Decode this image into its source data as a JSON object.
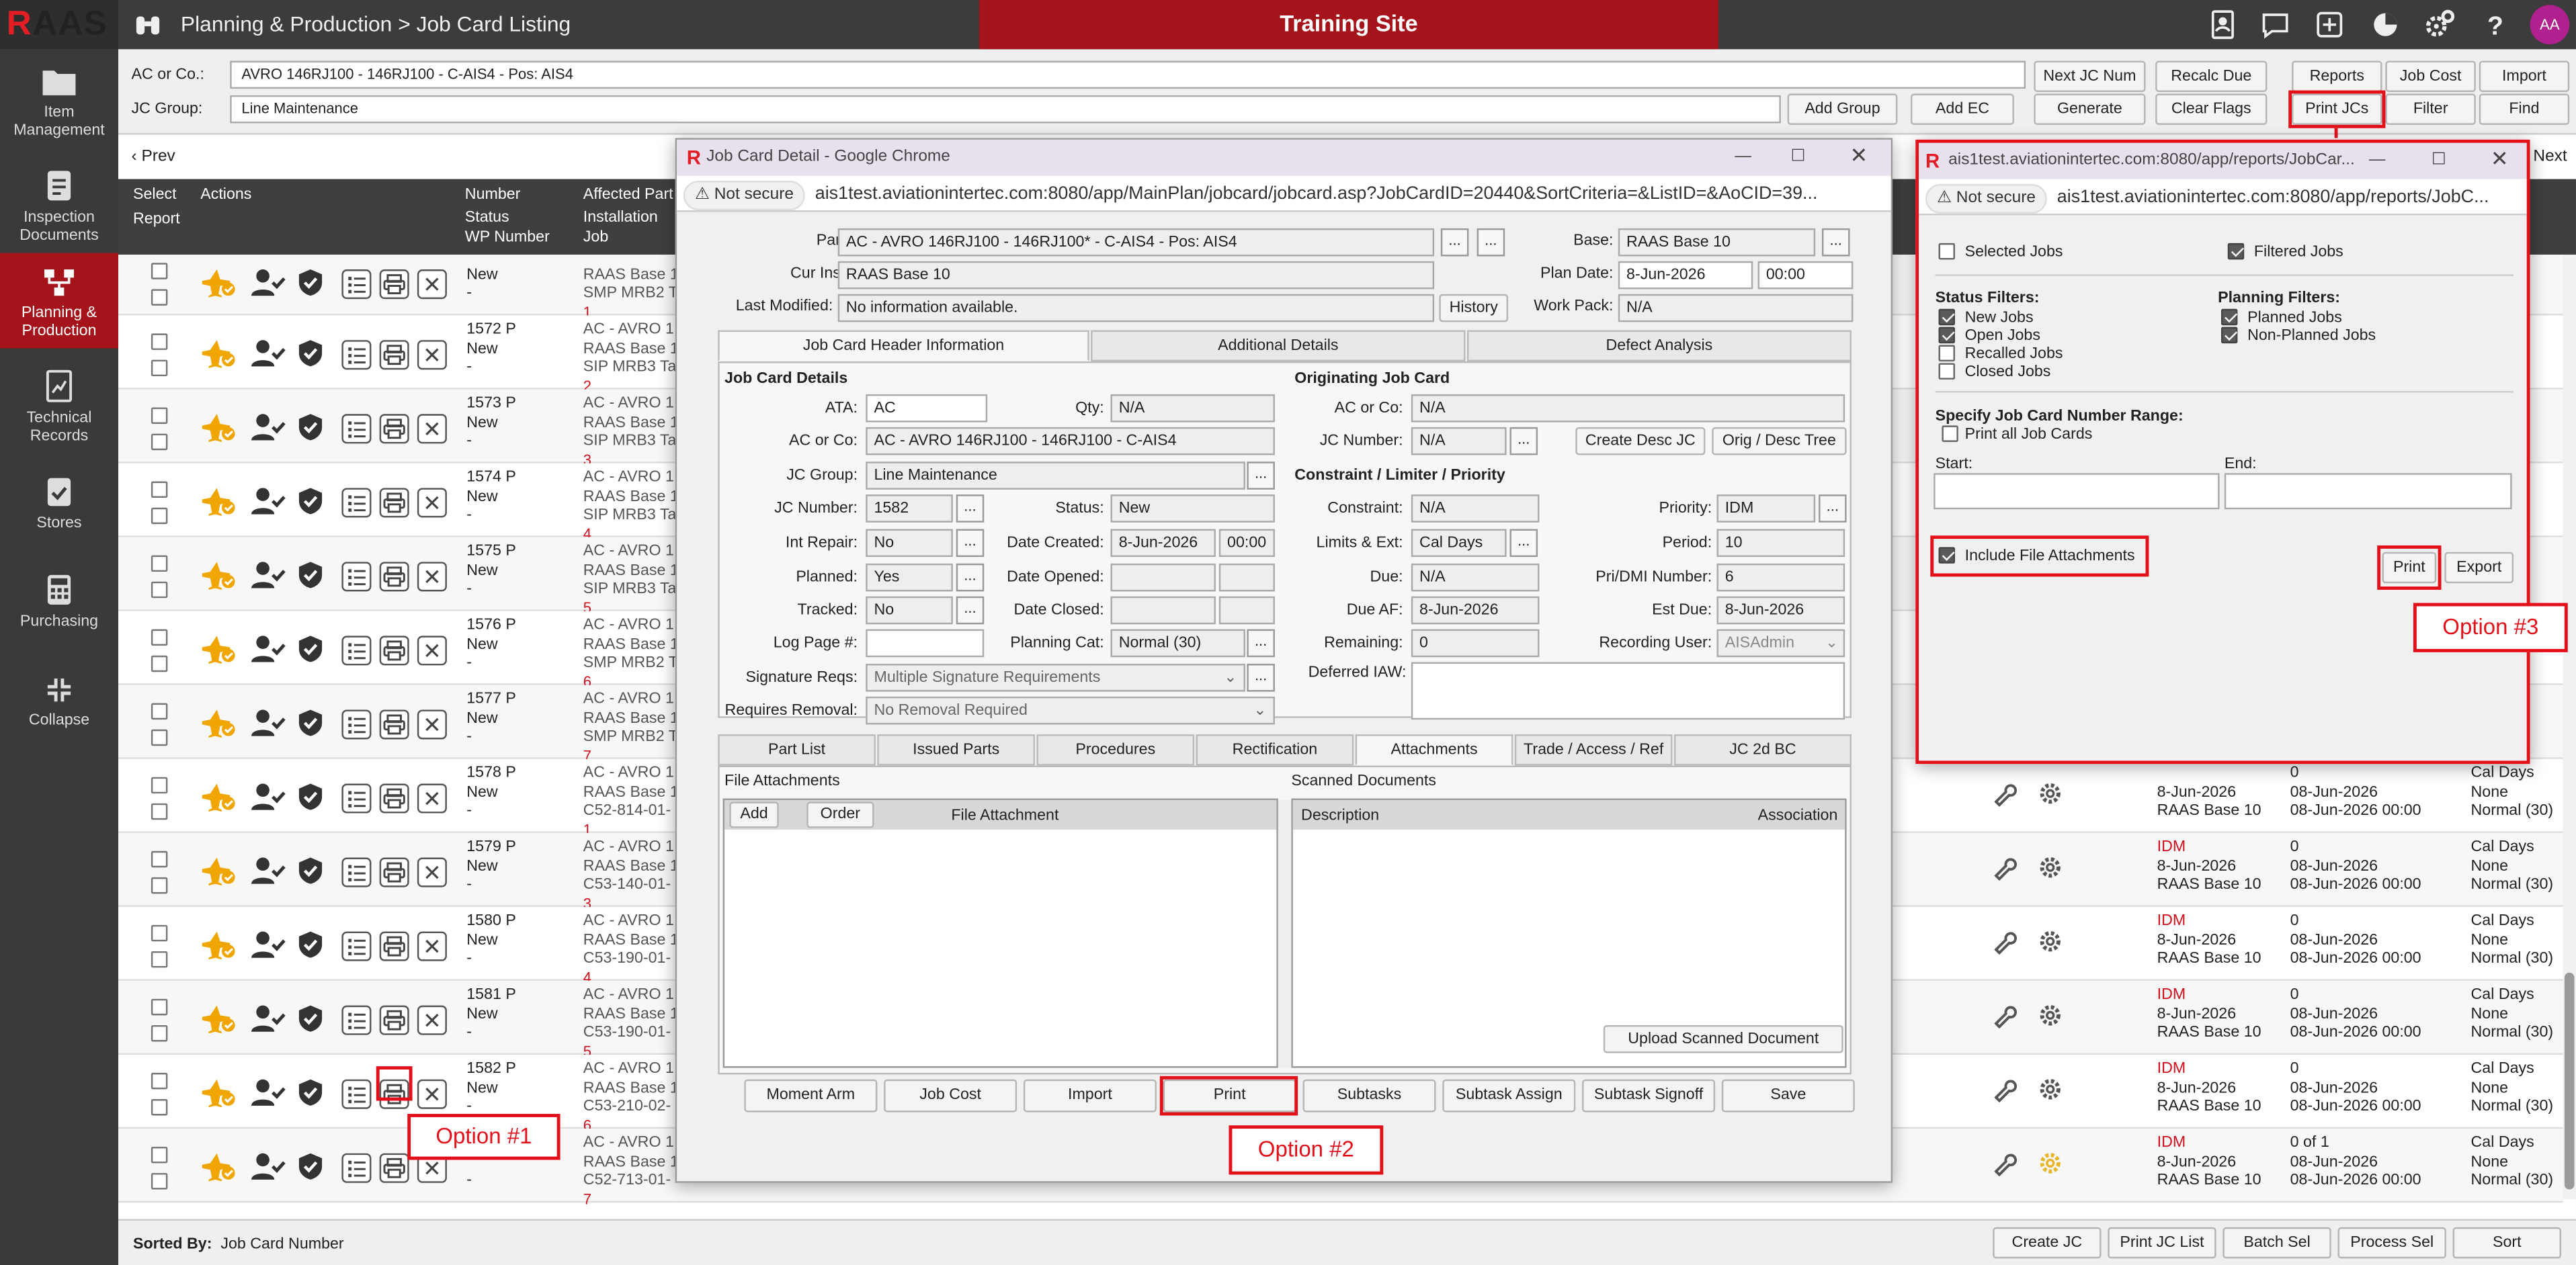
{
  "app": {
    "logo_r": "R",
    "logo_rest": "AAS",
    "breadcrumb": "Planning & Production > Job Card Listing",
    "banner": "Training Site",
    "avatar": "AA"
  },
  "sidebar": [
    {
      "label": "Item Management",
      "icon": "folder-icon"
    },
    {
      "label": "Inspection Documents",
      "icon": "clipboard-icon"
    },
    {
      "label": "Planning & Production",
      "icon": "flow-icon",
      "active": true
    },
    {
      "label": "Technical Records",
      "icon": "chart-doc-icon"
    },
    {
      "label": "Stores",
      "icon": "check-clipboard-icon"
    },
    {
      "label": "Purchasing",
      "icon": "calculator-icon"
    },
    {
      "label": "Collapse",
      "icon": "collapse-icon"
    }
  ],
  "filters": {
    "ac_label": "AC or Co.:",
    "ac_value": "AVRO 146RJ100 - 146RJ100 - C-AIS4 - Pos: AIS4",
    "jc_label": "JC Group:",
    "jc_value": "Line Maintenance"
  },
  "toolbar": {
    "add_group": "Add Group",
    "add_ec": "Add EC",
    "next_jc": "Next JC Num",
    "recalc": "Recalc Due",
    "generate": "Generate",
    "clear_flags": "Clear Flags",
    "reports": "Reports",
    "job_cost": "Job Cost",
    "import": "Import",
    "print_jcs": "Print JCs",
    "filter": "Filter",
    "find": "Find"
  },
  "grid": {
    "prev": "Prev",
    "next": "Next",
    "headers": {
      "select": "Select",
      "report": "Report",
      "actions": "Actions",
      "number": "Number",
      "status": "Status",
      "wp_number": "WP Number",
      "affected_part": "Affected Part",
      "installation": "Installation",
      "job": "Job"
    }
  },
  "rows": [
    {
      "num": "",
      "status": "New",
      "wp": "-",
      "aff1": "",
      "aff2": "RAAS Base 1",
      "aff3": "SMP MRB2 Ta",
      "seq": "1",
      "right": null
    },
    {
      "num": "1572 P",
      "status": "New",
      "wp": "-",
      "aff1": "AC - AVRO 1",
      "aff2": "RAAS Base 1",
      "aff3": "SIP MRB3 Tas",
      "seq": "2",
      "right": null
    },
    {
      "num": "1573 P",
      "status": "New",
      "wp": "-",
      "aff1": "AC - AVRO 1",
      "aff2": "RAAS Base 1",
      "aff3": "SIP MRB3 Tas",
      "seq": "3",
      "right": null
    },
    {
      "num": "1574 P",
      "status": "New",
      "wp": "-",
      "aff1": "AC - AVRO 1",
      "aff2": "RAAS Base 1",
      "aff3": "SIP MRB3 Tas",
      "seq": "4",
      "right": null
    },
    {
      "num": "1575 P",
      "status": "New",
      "wp": "-",
      "aff1": "AC - AVRO 1",
      "aff2": "RAAS Base 1",
      "aff3": "SIP MRB3 Tas",
      "seq": "5",
      "right": null
    },
    {
      "num": "1576 P",
      "status": "New",
      "wp": "-",
      "aff1": "AC - AVRO 1",
      "aff2": "RAAS Base 1",
      "aff3": "SMP MRB2 Tas",
      "seq": "6",
      "right": null
    },
    {
      "num": "1577 P",
      "status": "New",
      "wp": "-",
      "aff1": "AC - AVRO 1",
      "aff2": "RAAS Base 1",
      "aff3": "SMP MRB2 Tas",
      "seq": "7",
      "right": null
    },
    {
      "num": "1578 P",
      "status": "New",
      "wp": "-",
      "aff1": "AC - AVRO 1",
      "aff2": "RAAS Base 1",
      "aff3": "C52-814-01-",
      "seq": "1",
      "right": {
        "pri": "",
        "date": "8-Jun-2026",
        "base": "RAAS Base 10",
        "cnt": "0",
        "due": "08-Jun-2026",
        "due2": "08-Jun-2026 00:00",
        "per": "Cal Days",
        "lim": "None",
        "cat": "Normal (30)"
      }
    },
    {
      "num": "1579 P",
      "status": "New",
      "wp": "-",
      "aff1": "AC - AVRO 1",
      "aff2": "RAAS Base 1",
      "aff3": "C53-140-01-",
      "seq": "3",
      "right": {
        "pri": "IDM",
        "date": "8-Jun-2026",
        "base": "RAAS Base 10",
        "cnt": "0",
        "due": "08-Jun-2026",
        "due2": "08-Jun-2026 00:00",
        "per": "Cal Days",
        "lim": "None",
        "cat": "Normal (30)"
      }
    },
    {
      "num": "1580 P",
      "status": "New",
      "wp": "-",
      "aff1": "AC - AVRO 1",
      "aff2": "RAAS Base 1",
      "aff3": "C53-190-01-",
      "seq": "4",
      "right": {
        "pri": "IDM",
        "date": "8-Jun-2026",
        "base": "RAAS Base 10",
        "cnt": "0",
        "due": "08-Jun-2026",
        "due2": "08-Jun-2026 00:00",
        "per": "Cal Days",
        "lim": "None",
        "cat": "Normal (30)"
      }
    },
    {
      "num": "1581 P",
      "status": "New",
      "wp": "-",
      "aff1": "AC - AVRO 1",
      "aff2": "RAAS Base 1",
      "aff3": "C53-190-01-",
      "seq": "5",
      "right": {
        "pri": "IDM",
        "date": "8-Jun-2026",
        "base": "RAAS Base 10",
        "cnt": "0",
        "due": "08-Jun-2026",
        "due2": "08-Jun-2026 00:00",
        "per": "Cal Days",
        "lim": "None",
        "cat": "Normal (30)"
      }
    },
    {
      "num": "1582 P",
      "status": "New",
      "wp": "-",
      "aff1": "AC - AVRO 1",
      "aff2": "RAAS Base 1",
      "aff3": "C53-210-02-",
      "seq": "6",
      "right": {
        "pri": "IDM",
        "date": "8-Jun-2026",
        "base": "RAAS Base 10",
        "cnt": "0",
        "due": "08-Jun-2026",
        "due2": "08-Jun-2026 00:00",
        "per": "Cal Days",
        "lim": "None",
        "cat": "Normal (30)"
      }
    },
    {
      "num": "",
      "status": "",
      "wp": "-",
      "aff1": "AC - AVRO 1",
      "aff2": "RAAS Base 1",
      "aff3": "C52-713-01-",
      "seq": "7",
      "right": {
        "pri": "IDM",
        "date": "8-Jun-2026",
        "base": "RAAS Base 10",
        "cnt": "0 of 1",
        "due": "08-Jun-2026",
        "due2": "08-Jun-2026 00:00",
        "per": "Cal Days",
        "lim": "None",
        "cat": "Normal (30)"
      }
    }
  ],
  "bottom": {
    "sorted_label": "Sorted By:",
    "sorted_value": "Job Card Number",
    "create_jc": "Create JC",
    "print_jc_list": "Print JC List",
    "batch_sel": "Batch Sel",
    "process_sel": "Process Sel",
    "sort": "Sort"
  },
  "jcd": {
    "title": "Job Card Detail - Google Chrome",
    "not_secure": "Not secure",
    "url": "ais1test.aviationintertec.com:8080/app/MainPlan/jobcard/jobcard.asp?JobCardID=20440&SortCriteria=&ListID=&AoCID=39...",
    "part_label": "Part:",
    "part": "AC - AVRO 146RJ100 - 146RJ100* - C-AIS4 - Pos: AIS4",
    "base_label": "Base:",
    "base": "RAAS Base 10",
    "curinst_label": "Cur Inst:",
    "curinst": "RAAS Base 10",
    "plandate_label": "Plan Date:",
    "plandate": "8-Jun-2026",
    "plantime": "00:00",
    "lastmod_label": "Last Modified:",
    "lastmod": "No information available.",
    "history": "History",
    "workpack_label": "Work Pack:",
    "workpack": "N/A",
    "tabs": [
      "Job Card Header Information",
      "Additional Details",
      "Defect Analysis"
    ],
    "jcdetails": "Job Card Details",
    "ata_label": "ATA:",
    "ata": "AC",
    "qty_label": "Qty:",
    "qty": "N/A",
    "acco_label": "AC or Co:",
    "acco": "AC - AVRO 146RJ100 - 146RJ100 - C-AIS4",
    "jcgroup_label": "JC Group:",
    "jcgroup": "Line Maintenance",
    "jcnum_label": "JC Number:",
    "jcnum": "1582",
    "status_label": "Status:",
    "status": "New",
    "intrepair_label": "Int Repair:",
    "intrepair": "No",
    "datecreated_label": "Date Created:",
    "datecreated": "8-Jun-2026",
    "timecreated": "00:00",
    "planned_label": "Planned:",
    "planned": "Yes",
    "dateopened_label": "Date Opened:",
    "tracked_label": "Tracked:",
    "tracked": "No",
    "dateclosed_label": "Date Closed:",
    "logpage_label": "Log Page #:",
    "plancat_label": "Planning Cat:",
    "plancat": "Normal (30)",
    "sigreq_label": "Signature Reqs:",
    "sigreq": "Multiple Signature Requirements",
    "reqremoval_label": "Requires Removal:",
    "reqremoval": "No Removal Required",
    "origjc": "Originating Job Card",
    "oacco_label": "AC or Co:",
    "oacco": "N/A",
    "ojcnum_label": "JC Number:",
    "ojcnum": "N/A",
    "create_desc": "Create Desc JC",
    "orig_tree": "Orig / Desc Tree",
    "clp": "Constraint / Limiter / Priority",
    "constraint_label": "Constraint:",
    "constraint": "N/A",
    "priority_label": "Priority:",
    "priority": "IDM",
    "limits_label": "Limits & Ext:",
    "limits": "Cal Days",
    "period_label": "Period:",
    "period": "10",
    "due_label": "Due:",
    "due": "N/A",
    "pridmi_label": "Pri/DMI Number:",
    "pridmi": "6",
    "dueaf_label": "Due AF:",
    "dueaf": "8-Jun-2026",
    "estdue_label": "Est Due:",
    "estdue": "8-Jun-2026",
    "remaining_label": "Remaining:",
    "remaining": "0",
    "recuser_label": "Recording User:",
    "recuser": "AISAdmin",
    "deferred_label": "Deferred IAW:",
    "tabs2": [
      "Part List",
      "Issued Parts",
      "Procedures",
      "Rectification",
      "Attachments",
      "Trade / Access / Ref",
      "JC 2d BC"
    ],
    "fileatt": "File Attachments",
    "add": "Add",
    "order": "Order",
    "fileatt_col": "File Attachment",
    "scanned": "Scanned Documents",
    "desc_col": "Description",
    "assoc_col": "Association",
    "upload": "Upload Scanned Document",
    "buttons": [
      "Moment Arm",
      "Job Cost",
      "Import",
      "Print",
      "Subtasks",
      "Subtask Assign",
      "Subtask Signoff",
      "Save"
    ]
  },
  "pr": {
    "title": "ais1test.aviationintertec.com:8080/app/reports/JobCar...",
    "not_secure": "Not secure",
    "url": "ais1test.aviationintertec.com:8080/app/reports/JobC...",
    "selected_jobs": "Selected Jobs",
    "filtered_jobs": "Filtered Jobs",
    "status_filters": "Status Filters:",
    "new_jobs": "New Jobs",
    "open_jobs": "Open Jobs",
    "recalled_jobs": "Recalled Jobs",
    "closed_jobs": "Closed Jobs",
    "planning_filters": "Planning Filters:",
    "planned_jobs": "Planned Jobs",
    "nonplanned_jobs": "Non-Planned Jobs",
    "range_title": "Specify Job Card Number Range:",
    "print_all": "Print all Job Cards",
    "start_label": "Start:",
    "end_label": "End:",
    "include_att": "Include File Attachments",
    "print": "Print",
    "export": "Export"
  },
  "callouts": {
    "opt1": "Option #1",
    "opt2": "Option #2",
    "opt3": "Option #3"
  },
  "colors": {
    "brand_red": "#a4141a",
    "highlight_red": "#e3101a",
    "link_blue": "#1a6fb7",
    "star_gold": "#f0a500"
  }
}
